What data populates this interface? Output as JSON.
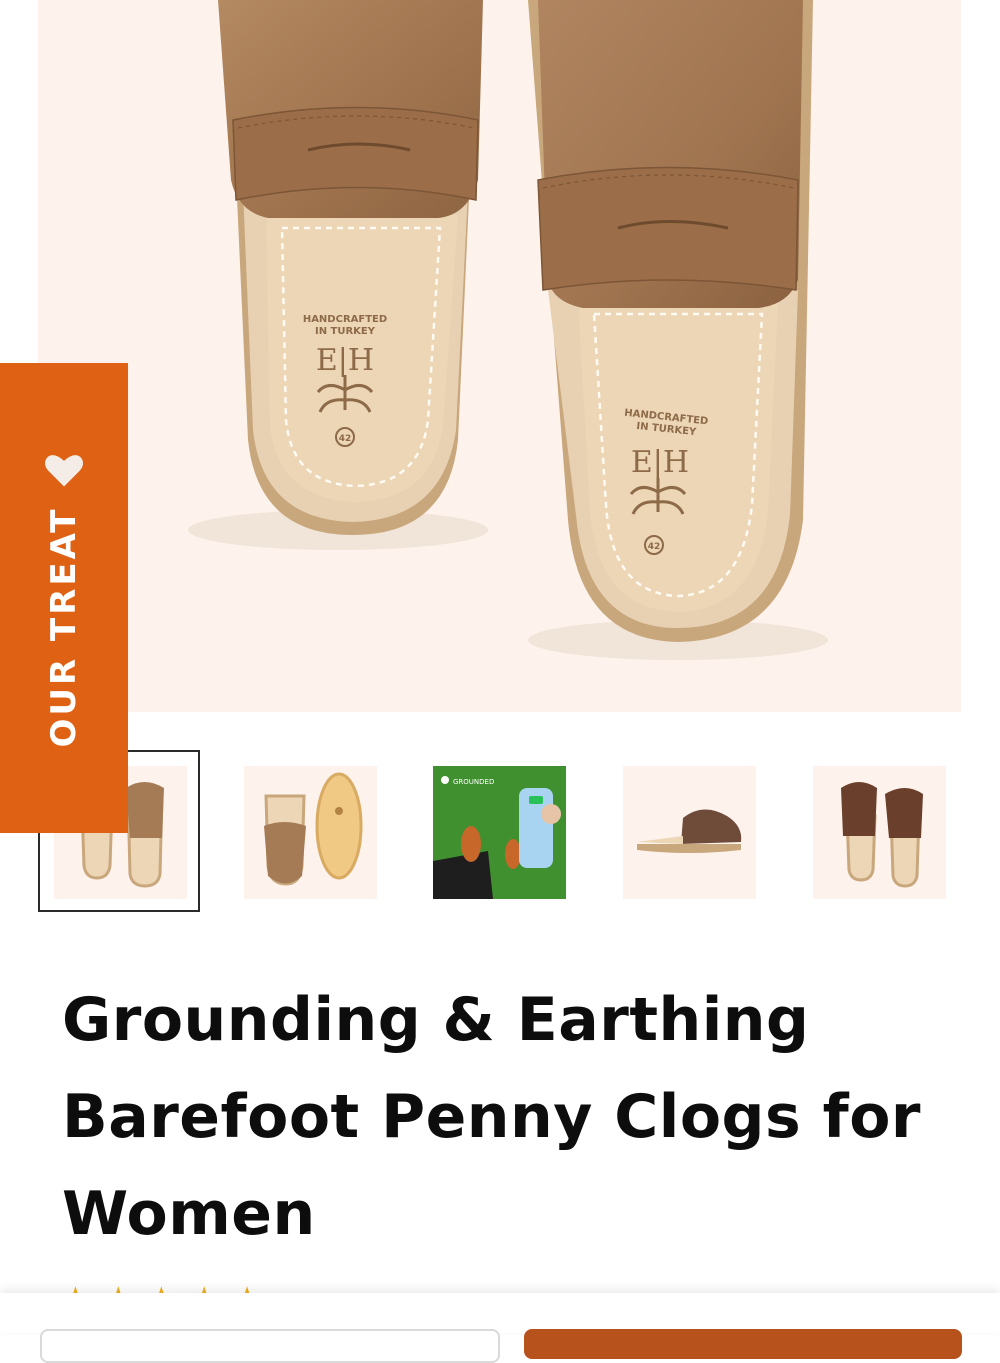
{
  "promo": {
    "label": "OUR TREAT",
    "icon": "heart-icon",
    "color": "#df6214"
  },
  "insole_text": {
    "line1": "HANDCRAFTED",
    "line2": "IN TURKEY",
    "brand": "E|H",
    "size": "42"
  },
  "thumbnails": [
    {
      "name": "thumb-top-view",
      "selected": true
    },
    {
      "name": "thumb-side-sole-view",
      "selected": false
    },
    {
      "name": "thumb-grounded-test",
      "selected": false,
      "badge": "GROUNDED"
    },
    {
      "name": "thumb-side-view",
      "selected": false
    },
    {
      "name": "thumb-dark-brown",
      "selected": false
    }
  ],
  "product": {
    "title": "Grounding & Earthing Barefoot Penny Clogs for Women"
  },
  "rating": {
    "stars": 5
  },
  "colors": {
    "accent": "#df6214",
    "image_bg": "#fdf3ec",
    "leather": "#a57b55",
    "insole": "#ecd6b6"
  }
}
